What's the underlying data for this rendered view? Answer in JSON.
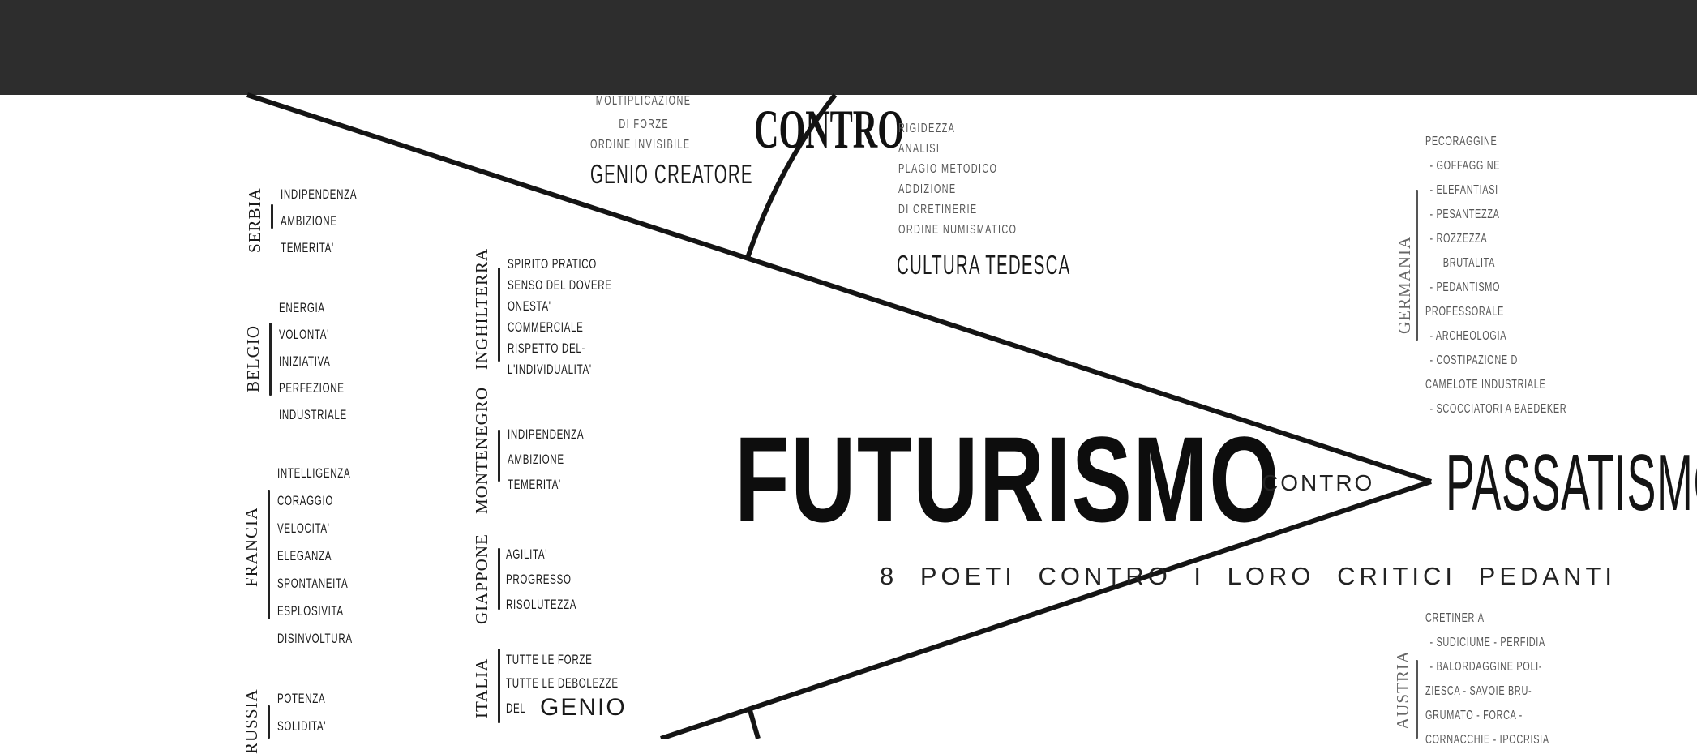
{
  "header": {
    "bg_color": "#2d2d2d"
  },
  "center": {
    "futurismo": "FUTURISMO",
    "contro_small": "CONTRO",
    "passatismo": "PASSATISMO",
    "subtitle": "8 POETI CONTRO I LORO CRITICI PEDANTI",
    "contro_big": "CONTRO"
  },
  "top_block": {
    "lines": [
      "MOLTIPLICAZIONE",
      "DI FORZE",
      "ORDINE INVISIBILE"
    ],
    "title": "GENIO CREATORE"
  },
  "cultura_block": {
    "lines": [
      "RIGIDEZZA",
      "ANALISI",
      "PLAGIO METODICO",
      "ADDIZIONE",
      "DI CRETINERIE",
      "ORDINE NUMISMATICO"
    ],
    "title": "CULTURA TEDESCA"
  },
  "countries_left": [
    {
      "name": "SERBIA",
      "items": [
        "INDIPENDENZA",
        "AMBIZIONE",
        "TEMERITA'"
      ]
    },
    {
      "name": "BELGIO",
      "items": [
        "ENERGIA",
        "VOLONTA'",
        "INIZIATIVA",
        "PERFEZIONE",
        "INDUSTRIALE"
      ]
    },
    {
      "name": "FRANCIA",
      "items": [
        "INTELLIGENZA",
        "CORAGGIO",
        "VELOCITA'",
        "ELEGANZA",
        "SPONTANEITA'",
        "ESPLOSIVITA",
        "DISINVOLTURA"
      ]
    },
    {
      "name": "RUSSIA",
      "items": [
        "POTENZA",
        "SOLIDITA'"
      ]
    }
  ],
  "countries_mid": [
    {
      "name": "INGHILTERRA",
      "items": [
        "SPIRITO PRATICO",
        "SENSO DEL DOVERE",
        "ONESTA'",
        "COMMERCIALE",
        "RISPETTO DEL-",
        "L'INDIVIDUALITA'"
      ]
    },
    {
      "name": "MONTENEGRO",
      "items": [
        "INDIPENDENZA",
        "AMBIZIONE",
        "TEMERITA'"
      ]
    },
    {
      "name": "GIAPPONE",
      "items": [
        "AGILITA'",
        "PROGRESSO",
        "RISOLUTEZZA"
      ]
    },
    {
      "name": "ITALIA",
      "items": [
        "TUTTE LE FORZE",
        "TUTTE LE DEBOLEZZE"
      ],
      "last_prefix": "DEL",
      "last_big": "GENIO"
    }
  ],
  "germania": {
    "name": "GERMANIA",
    "items": [
      "PECORAGGINE",
      "- GOFFAGGINE",
      "- ELEFANTIASI",
      "- PESANTEZZA",
      "- ROZZEZZA",
      "BRUTALITA",
      "- PEDANTISMO",
      "PROFESSORALE",
      "- ARCHEOLOGIA",
      "- COSTIPAZIONE DI",
      "CAMELOTE INDUSTRIALE",
      "- SCOCCIATORI A BAEDEKER"
    ]
  },
  "austria": {
    "name": "AUSTRIA",
    "items": [
      "CRETINERIA",
      "- SUDICIUME - PERFIDIA",
      "- BALORDAGGINE POLI-",
      "ZIESCA - SAVOIE BRU-",
      "GRUMATO - FORCA -",
      "CORNACCHIE - IPOCRISIA"
    ]
  }
}
